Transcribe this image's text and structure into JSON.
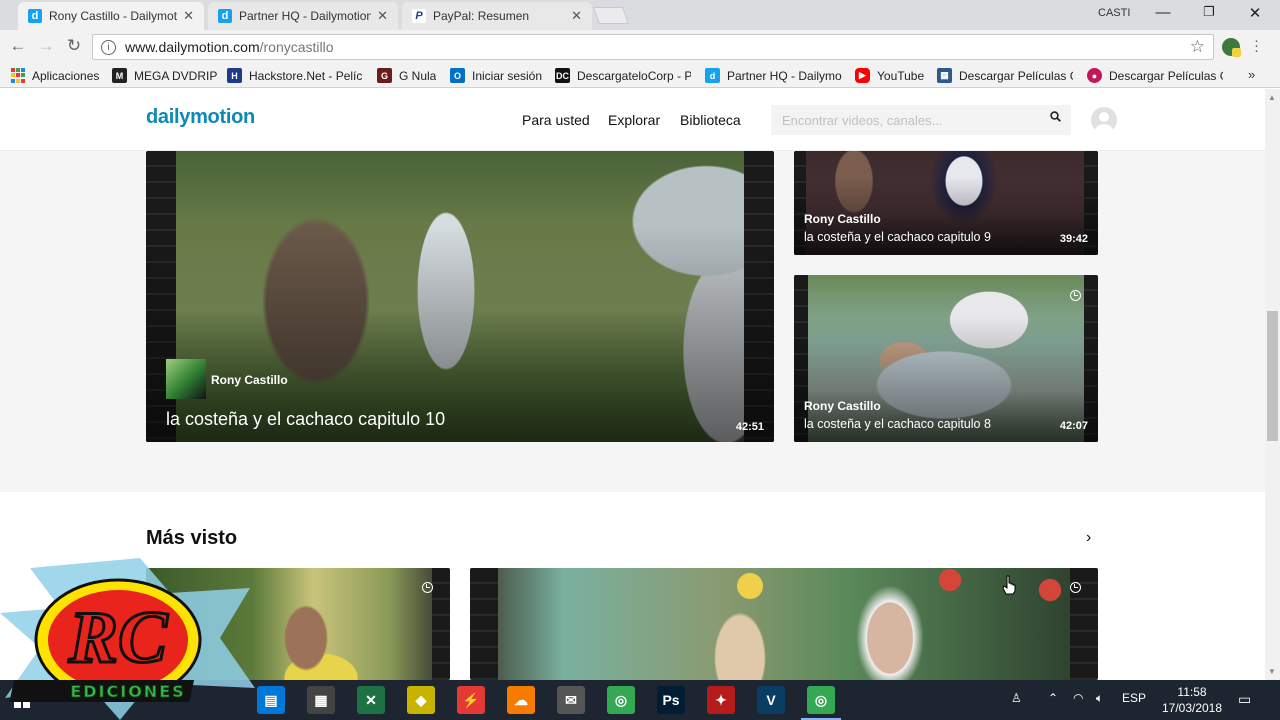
{
  "browser": {
    "tabs": [
      {
        "title": "Rony Castillo - Dailymoti",
        "favicon": "dailymotion-favicon",
        "icon_letter": "d",
        "color": "#15a3ef",
        "active": true
      },
      {
        "title": "Partner HQ - Dailymotion",
        "favicon": "dailymotion-favicon",
        "icon_letter": "d",
        "color": "#15a3ef",
        "active": false
      },
      {
        "title": "PayPal: Resumen",
        "favicon": "paypal-favicon",
        "icon_letter": "P",
        "color": "#253b80",
        "active": false
      }
    ],
    "profile_name": "CASTI",
    "url": {
      "host": "www.dailymotion.com",
      "path": "/ronycastillo"
    },
    "bookmarks": [
      {
        "label": "Aplicaciones",
        "icon": "apps-grid-icon",
        "color": "#e53935"
      },
      {
        "label": "MEGA DVDRIP",
        "icon": "mega-dvdrip-icon",
        "color": "#222222"
      },
      {
        "label": "Hackstore.Net - Pelíc",
        "icon": "hackstore-icon",
        "color": "#1e3a8a"
      },
      {
        "label": "G Nula",
        "icon": "gnula-icon",
        "color": "#6b1d1d"
      },
      {
        "label": "Iniciar sesión",
        "icon": "outlook-icon",
        "color": "#0072c6"
      },
      {
        "label": "DescargateloCorp - P",
        "icon": "dc-icon",
        "color": "#111111"
      },
      {
        "label": "Partner HQ - Dailymo",
        "icon": "dailymotion-favicon",
        "color": "#15a3ef"
      },
      {
        "label": "YouTube",
        "icon": "youtube-icon",
        "color": "#ff0000"
      },
      {
        "label": "Descargar Películas G",
        "icon": "film-icon",
        "color": "#2a5b8c"
      },
      {
        "label": "Descargar Películas G",
        "icon": "film-pink-icon",
        "color": "#c2185b"
      }
    ],
    "bookmarks_more": "»"
  },
  "site": {
    "logo": "dailymotion",
    "nav": [
      "Para usted",
      "Explorar",
      "Biblioteca"
    ],
    "search_placeholder": "Encontrar videos, canales..."
  },
  "featured": {
    "main": {
      "owner": "Rony Castillo",
      "title": "la costeña y el cachaco capitulo 10",
      "duration": "42:51"
    },
    "side": [
      {
        "owner": "Rony Castillo",
        "title": "la costeña y el cachaco capitulo 9",
        "duration": "39:42"
      },
      {
        "owner": "Rony Castillo",
        "title": "la costeña y el cachaco capitulo 8",
        "duration": "42:07"
      }
    ]
  },
  "most_viewed": {
    "title": "Más visto"
  },
  "watermark": {
    "letters": "RC",
    "caption": "EDICIONES"
  },
  "taskbar": {
    "language": "ESP",
    "time": "11:58",
    "date": "17/03/2018",
    "apps": [
      {
        "name": "store-icon",
        "color": "#0078d7"
      },
      {
        "name": "calculator-icon",
        "color": "#444444"
      },
      {
        "name": "excel-like-icon",
        "color": "#1e7145"
      },
      {
        "name": "winamp-icon",
        "color": "#c8b400"
      },
      {
        "name": "flash-icon",
        "color": "#e53935"
      },
      {
        "name": "cloud-icon",
        "color": "#f57c00"
      },
      {
        "name": "mail-icon",
        "color": "#555555"
      },
      {
        "name": "chrome-icon",
        "color": "#34a853"
      },
      {
        "name": "photoshop-icon",
        "color": "#001d34"
      },
      {
        "name": "star-app-icon",
        "color": "#b71c1c"
      },
      {
        "name": "vegas-icon",
        "color": "#0a3d62"
      },
      {
        "name": "chrome-active-icon",
        "color": "#34a853"
      }
    ]
  }
}
